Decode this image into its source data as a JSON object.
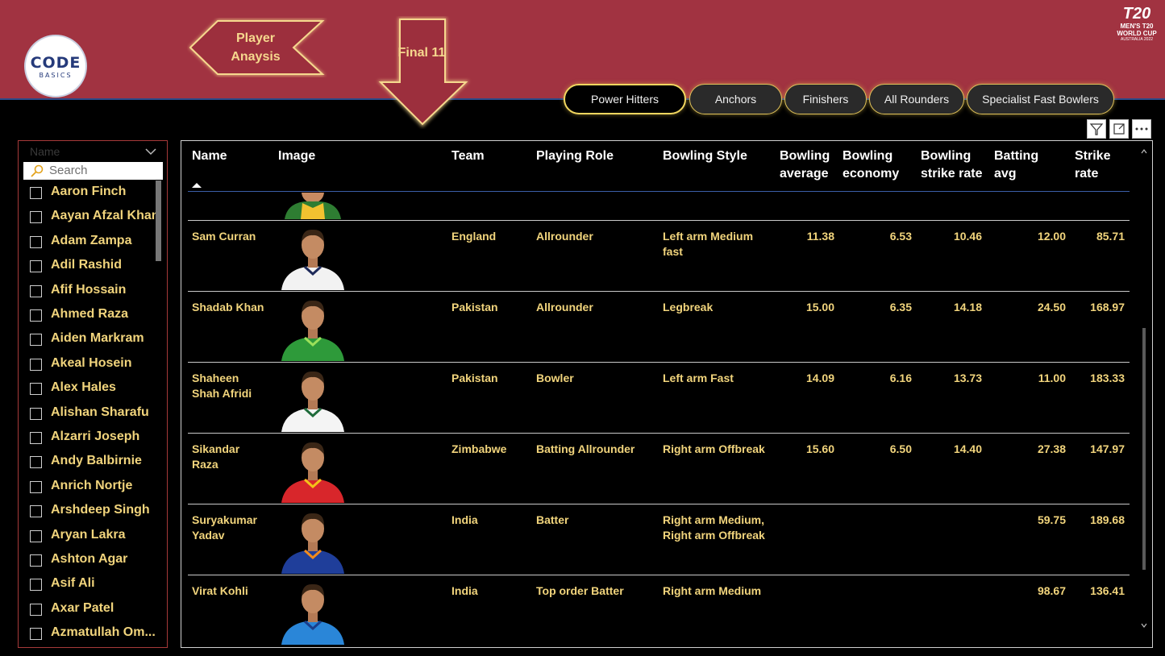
{
  "colors": {
    "header": "#a13341",
    "gold": "#f1d47c",
    "accent_border": "#f1d65f"
  },
  "logo": {
    "brand": "CODE",
    "sub": "BASICS"
  },
  "nav": {
    "player_label": "Player Anaysis",
    "final_label": "Final 11"
  },
  "wc_logo": {
    "t20": "T20",
    "line1": "MEN'S T20",
    "line2": "WORLD CUP",
    "line3": "AUSTRALIA 2022"
  },
  "tabs": [
    {
      "label": "Power Hitters",
      "active": true
    },
    {
      "label": "Anchors",
      "active": false
    },
    {
      "label": "Finishers",
      "active": false
    },
    {
      "label": "All Rounders",
      "active": false
    },
    {
      "label": "Specialist Fast Bowlers",
      "active": false
    }
  ],
  "slicer": {
    "title": "Name",
    "search_placeholder": "Search",
    "items": [
      "Aaron Finch",
      "Aayan Afzal Khan",
      "Adam Zampa",
      "Adil Rashid",
      "Afif Hossain",
      "Ahmed Raza",
      "Aiden Markram",
      "Akeal Hosein",
      "Alex Hales",
      "Alishan Sharafu",
      "Alzarri Joseph",
      "Andy Balbirnie",
      "Anrich Nortje",
      "Arshdeep Singh",
      "Aryan Lakra",
      "Ashton Agar",
      "Asif Ali",
      "Axar Patel",
      "Azmatullah Om..."
    ]
  },
  "visual_icons": [
    "filter-icon",
    "focus-mode-icon",
    "more-options-icon"
  ],
  "table": {
    "columns": [
      "Name",
      "Image",
      "Team",
      "Playing Role",
      "Bowling Style",
      "Bowling average",
      "Bowling economy",
      "Bowling strike rate",
      "Batting avg",
      "Strike rate"
    ],
    "rows": [
      {
        "name": "Sam Curran",
        "team": "England",
        "role": "Allrounder",
        "style": "Left arm Medium fast",
        "bowl_avg": "11.38",
        "economy": "6.53",
        "bowl_sr": "10.46",
        "bat_avg": "12.00",
        "strike_rate": "85.71",
        "jersey": "#f2f2f2",
        "trim": "#1e2a5a"
      },
      {
        "name": "Shadab Khan",
        "team": "Pakistan",
        "role": "Allrounder",
        "style": "Legbreak",
        "bowl_avg": "15.00",
        "economy": "6.35",
        "bowl_sr": "14.18",
        "bat_avg": "24.50",
        "strike_rate": "168.97",
        "jersey": "#2e9a3a",
        "trim": "#9be05a"
      },
      {
        "name": "Shaheen Shah Afridi",
        "team": "Pakistan",
        "role": "Bowler",
        "style": "Left arm Fast",
        "bowl_avg": "14.09",
        "economy": "6.16",
        "bowl_sr": "13.73",
        "bat_avg": "11.00",
        "strike_rate": "183.33",
        "jersey": "#f4f4f4",
        "trim": "#1f6b3a"
      },
      {
        "name": "Sikandar Raza",
        "team": "Zimbabwe",
        "role": "Batting Allrounder",
        "style": "Right arm Offbreak",
        "bowl_avg": "15.60",
        "economy": "6.50",
        "bowl_sr": "14.40",
        "bat_avg": "27.38",
        "strike_rate": "147.97",
        "jersey": "#d8262b",
        "trim": "#f3c21a"
      },
      {
        "name": "Suryakumar Yadav",
        "team": "India",
        "role": "Batter",
        "style": "Right arm Medium, Right arm Offbreak",
        "bowl_avg": "",
        "economy": "",
        "bowl_sr": "",
        "bat_avg": "59.75",
        "strike_rate": "189.68",
        "jersey": "#1f3e9a",
        "trim": "#f28b1c"
      },
      {
        "name": "Virat Kohli",
        "team": "India",
        "role": "Top order Batter",
        "style": "Right arm Medium",
        "bowl_avg": "",
        "economy": "",
        "bowl_sr": "",
        "bat_avg": "98.67",
        "strike_rate": "136.41",
        "jersey": "#2a86d8",
        "trim": "#1a3d8a"
      }
    ]
  }
}
